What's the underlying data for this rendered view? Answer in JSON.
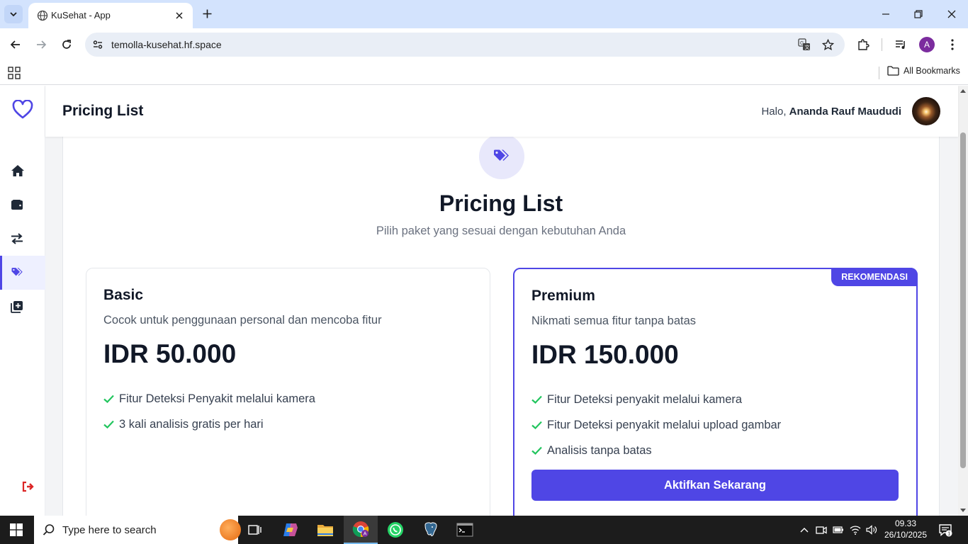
{
  "browser": {
    "tab_title": "KuSehat - App",
    "url": "temolla-kusehat.hf.space",
    "profile_initial": "A",
    "bookmarks_label": "All Bookmarks"
  },
  "app": {
    "header_title": "Pricing List",
    "greeting_prefix": "Halo,",
    "user_name": "Ananda Rauf Maududi",
    "sidebar": [
      {
        "icon": "home-icon",
        "active": false
      },
      {
        "icon": "wallet-icon",
        "active": false
      },
      {
        "icon": "exchange-icon",
        "active": false
      },
      {
        "icon": "tags-icon",
        "active": true
      },
      {
        "icon": "add-photo-icon",
        "active": false
      }
    ],
    "accent_color": "#4f46e5"
  },
  "page": {
    "heading": "Pricing List",
    "subheading": "Pilih paket yang sesuai dengan kebutuhan Anda"
  },
  "plans": [
    {
      "name": "Basic",
      "description": "Cocok untuk penggunaan personal dan mencoba fitur",
      "price": "IDR 50.000",
      "features": [
        "Fitur Deteksi Penyakit melalui kamera",
        "3 kali analisis gratis per hari"
      ]
    },
    {
      "name": "Premium",
      "badge": "REKOMENDASI",
      "description": "Nikmati semua fitur tanpa batas",
      "price": "IDR 150.000",
      "features": [
        "Fitur Deteksi penyakit melalui kamera",
        "Fitur Deteksi penyakit melalui upload gambar",
        "Analisis tanpa batas"
      ],
      "cta": "Aktifkan Sekarang"
    }
  ],
  "taskbar": {
    "search_placeholder": "Type here to search",
    "time": "09.33",
    "date": "26/10/2025",
    "notification_count": "1"
  }
}
